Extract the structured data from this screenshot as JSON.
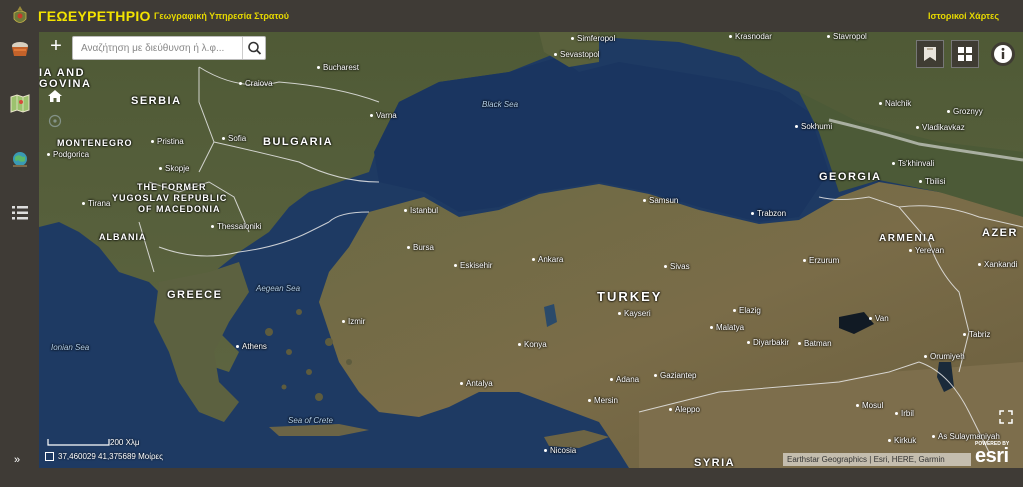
{
  "header": {
    "title": "ΓΕΩΕΥΡΕΤΗΡΙΟ",
    "subtitle": "Γεωγραφική Υπηρεσία Στρατού",
    "historic_maps": "Ιστορικοί Χάρτες"
  },
  "sidebar": {
    "items": [
      {
        "icon": "basket-icon"
      },
      {
        "icon": "map-layers-icon"
      },
      {
        "icon": "globe-icon"
      },
      {
        "icon": "list-icon"
      }
    ],
    "expand_label": "»"
  },
  "search": {
    "placeholder": "Αναζήτηση με διεύθυνση ή λ.φ...",
    "value": ""
  },
  "map": {
    "countries": [
      "SERBIA",
      "BULGARIA",
      "MONTENEGRO",
      "THE FORMER",
      "YUGOSLAV REPUBLIC",
      "OF MACEDONIA",
      "ALBANIA",
      "GREECE",
      "TURKEY",
      "GEORGIA",
      "ARMENIA",
      "AZER",
      "SYRIA",
      "IA AND",
      "GOVINA"
    ],
    "seas": [
      "Black Sea",
      "Aegean Sea",
      "Ionian Sea",
      "Sea of Crete"
    ],
    "cities": [
      "Bucharest",
      "Craiova",
      "Simferopol",
      "Sevastopol",
      "Krasnodar",
      "Stavropol",
      "Nalchik",
      "Groznyy",
      "Vladikavkaz",
      "Sokhumi",
      "Ts'khinvali",
      "Tbilisi",
      "Varna",
      "Sofia",
      "Pristina",
      "Skopje",
      "Podgorica",
      "Tirana",
      "Thessaloniki",
      "Istanbul",
      "Bursa",
      "Eskisehir",
      "Ankara",
      "Samsun",
      "Trabzon",
      "Sivas",
      "Erzurum",
      "Yerevan",
      "Xankandi",
      "Kayseri",
      "Elazig",
      "Malatya",
      "Diyarbakir",
      "Batman",
      "Van",
      "Tabriz",
      "Orumiyeh",
      "Izmir",
      "Athens",
      "Konya",
      "Antalya",
      "Adana",
      "Mersin",
      "Gaziantep",
      "Aleppo",
      "Mosul",
      "Irbil",
      "Kirkuk",
      "As Sulaymaniyah",
      "Nicosia"
    ],
    "water_color": "#1f3a62",
    "land_color": "#5e5a3a"
  },
  "scale": {
    "label": "200 Χλμ"
  },
  "coordinates": {
    "text": "37,460029 41,375689 Μοίρες"
  },
  "attribution": "Earthstar Geographics | Esri, HERE, Garmin",
  "esri": {
    "powered": "POWERED BY",
    "name": "esri"
  }
}
